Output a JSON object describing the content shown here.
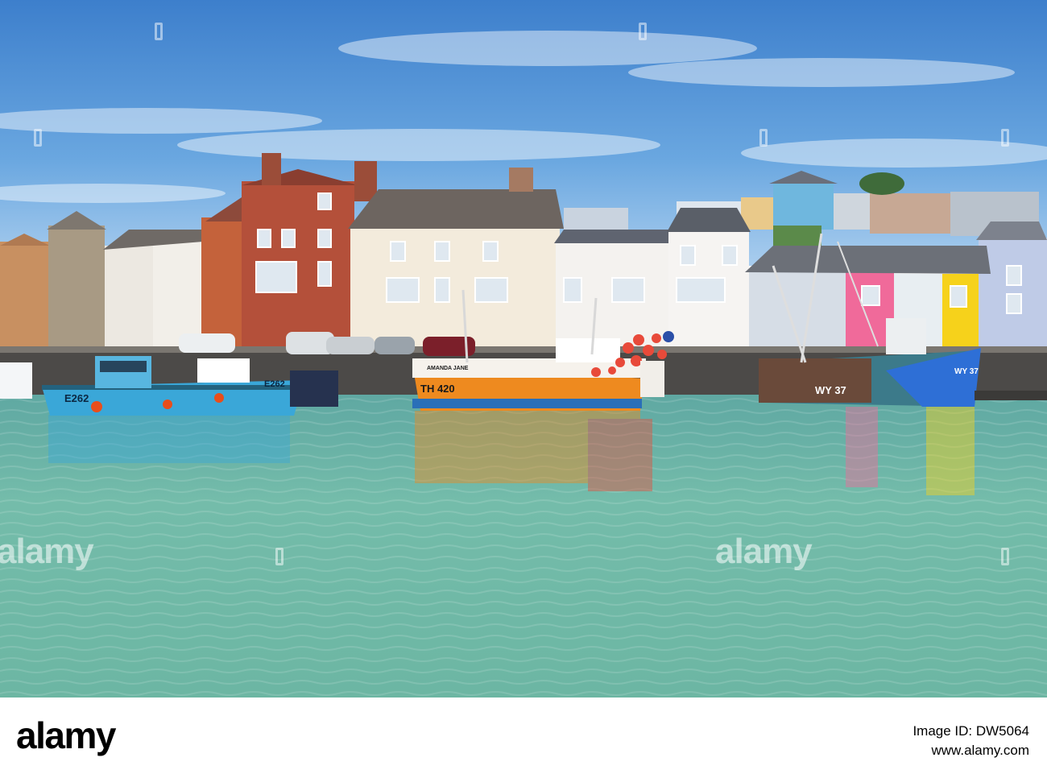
{
  "scene": {
    "boat_registrations": [
      "E262",
      "TH 420",
      "WY 37"
    ],
    "boat_names": [
      "AMANDA JANE"
    ],
    "colors": {
      "sky": "#4f8fd2",
      "water": "#6fb7a5",
      "orange_hull": "#ee8a1f",
      "blue_hull": "#3aa7d8"
    }
  },
  "watermark": {
    "text": "alamy"
  },
  "footer": {
    "logo": "alamy",
    "image_id": "Image ID: DW5064",
    "url": "www.alamy.com"
  }
}
